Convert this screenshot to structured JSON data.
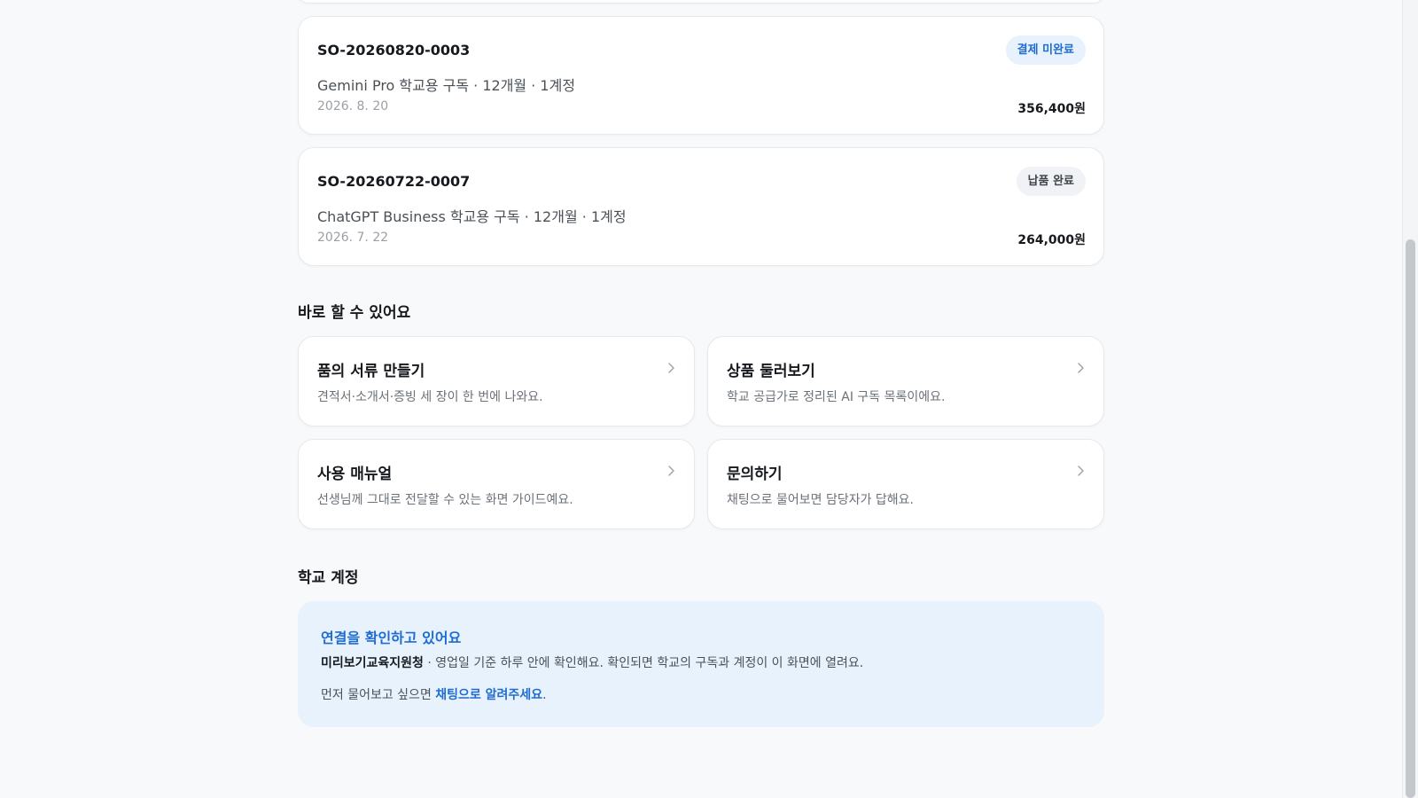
{
  "orders": [
    {
      "id": "SO-20260820-0003",
      "status": "결제 미완료",
      "description": "Gemini Pro 학교용 구독 · 12개월 · 1계정",
      "date": "2026. 8. 20",
      "amount": "356,400원"
    },
    {
      "id": "SO-20260722-0007",
      "status": "납품 완료",
      "description": "ChatGPT Business 학교용 구독 · 12개월 · 1계정",
      "date": "2026. 7. 22",
      "amount": "264,000원"
    }
  ],
  "quick_actions": {
    "title": "바로 할 수 있어요",
    "items": [
      {
        "title": "품의 서류 만들기",
        "description": "견적서·소개서·증빙 세 장이 한 번에 나와요.",
        "icon": "chevron-right-icon"
      },
      {
        "title": "상품 둘러보기",
        "description": "학교 공급가로 정리된 AI 구독 목록이에요.",
        "icon": "chevron-right-icon"
      },
      {
        "title": "사용 매뉴얼",
        "description": "선생님께 그대로 전달할 수 있는 화면 가이드예요.",
        "icon": "chevron-right-icon"
      },
      {
        "title": "문의하기",
        "description": "채팅으로 물어보면 담당자가 답해요.",
        "icon": "chevron-right-icon"
      }
    ]
  },
  "school_account": {
    "title": "학교 계정",
    "notice_title": "연결을 확인하고 있어요",
    "org_name": "미리보기교육지원청",
    "line1_rest": " · 영업일 기준 하루 안에 확인해요. 확인되면 학교의 구독과 계정이 이 화면에 열려요.",
    "line2_prefix": "먼저 물어보고 싶으면 ",
    "line2_link": "채팅으로 알려주세요",
    "line2_suffix": "."
  },
  "colors": {
    "accent": "#1f6ccf",
    "badge_unpaid_bg": "#e8f2fd",
    "badge_delivered_bg": "#f0f2f5",
    "notice_bg": "#e8f2fd",
    "page_bg": "#f8f9fb"
  }
}
